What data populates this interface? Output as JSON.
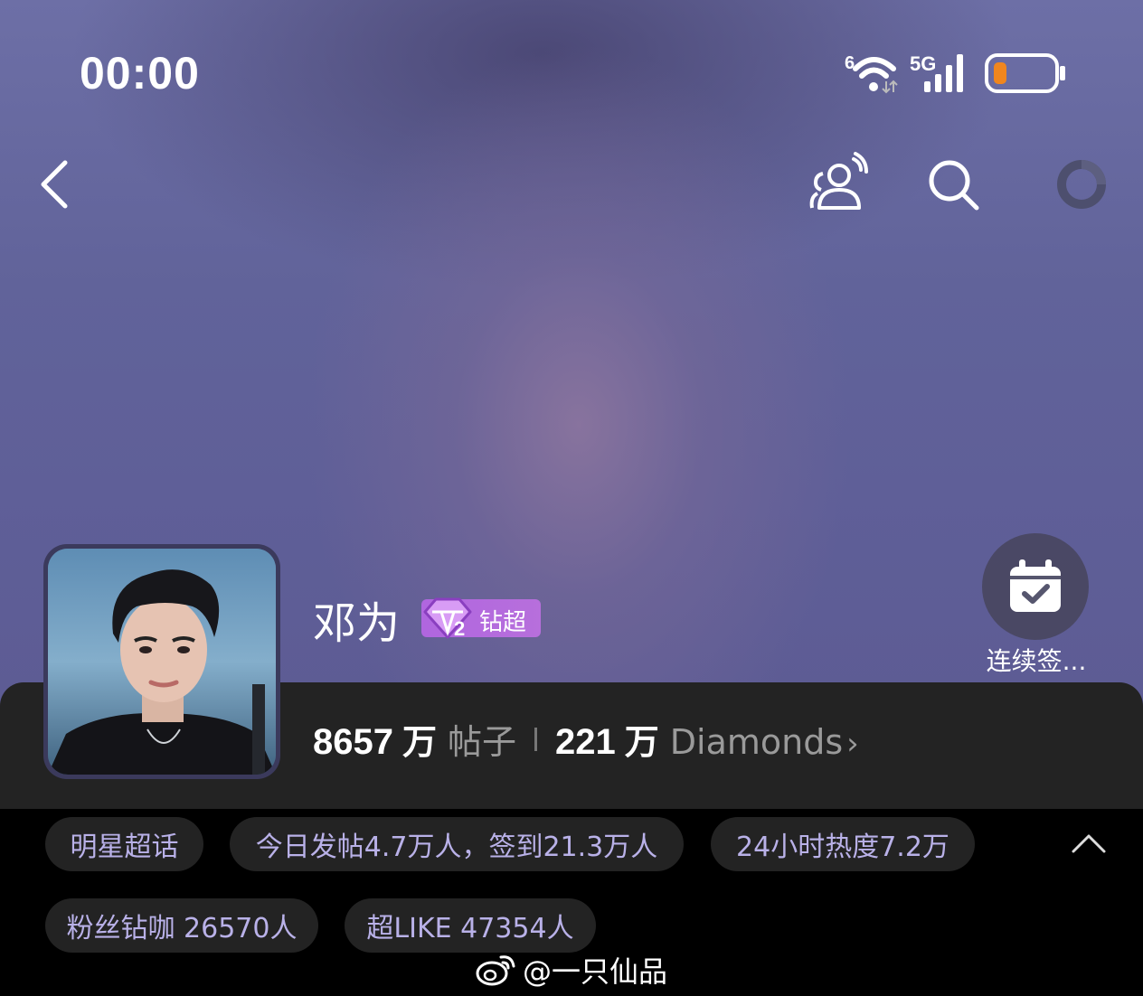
{
  "status_bar": {
    "time": "00:00",
    "wifi_badge": "6",
    "network": "5G",
    "icons": [
      "wifi-icon",
      "signal-icon",
      "battery-icon"
    ]
  },
  "nav": {
    "icons": [
      "back-icon",
      "group-chat-icon",
      "search-icon",
      "loading-icon"
    ]
  },
  "topic": {
    "name": "邓为",
    "badge_level": "2",
    "badge_label": "钻超"
  },
  "checkin": {
    "label": "连续签..."
  },
  "stats": {
    "posts_value": "8657",
    "posts_unit": "万",
    "posts_label": "帖子",
    "diamonds_value": "221",
    "diamonds_unit": "万",
    "diamonds_label": "Diamonds"
  },
  "tags": [
    "明星超话",
    "今日发帖4.7万人，签到21.3万人",
    "24小时热度7.2万",
    "粉丝钻咖 26570人",
    "超LIKE 47354人"
  ],
  "watermark": {
    "text": "@一只仙品"
  },
  "colors": {
    "hero_bg": "#61639a",
    "panel_bg": "#232323",
    "tag_text": "#b9b1e8",
    "badge": "#b066df",
    "battery_low": "#f0861e"
  }
}
